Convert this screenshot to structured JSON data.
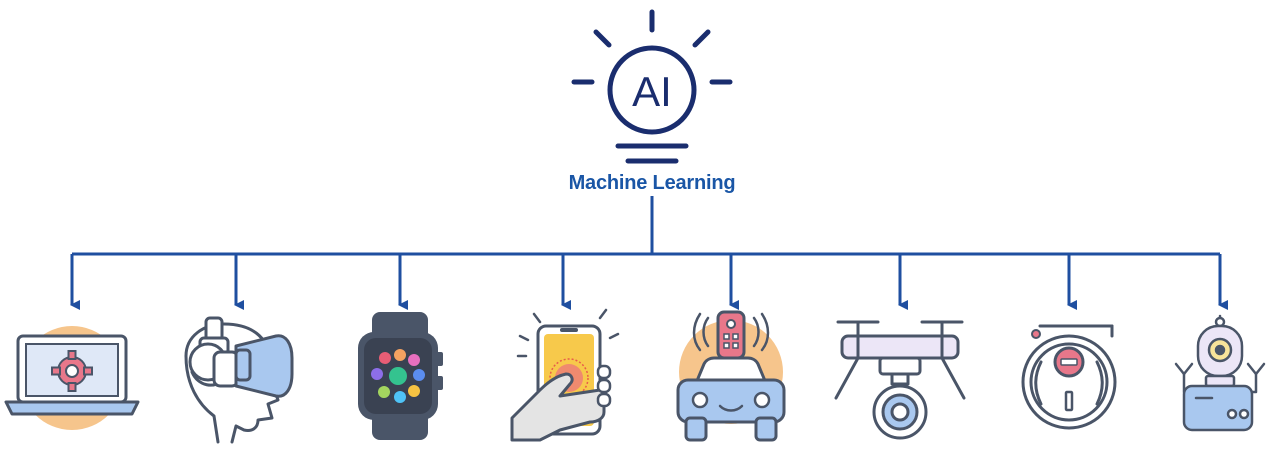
{
  "header": {
    "bulb_text": "AI",
    "title": "Machine Learning"
  },
  "devices": [
    {
      "name": "laptop-gear-icon"
    },
    {
      "name": "vr-headset-icon"
    },
    {
      "name": "smartwatch-icon"
    },
    {
      "name": "smartphone-touch-icon"
    },
    {
      "name": "remote-controlled-car-icon"
    },
    {
      "name": "camera-drone-icon"
    },
    {
      "name": "robot-vacuum-icon"
    },
    {
      "name": "robot-icon"
    }
  ],
  "colors": {
    "navy": "#1a2d6e",
    "connector_blue": "#1f4fa0",
    "title_blue": "#1a56a6",
    "outline": "#4a5568",
    "accent_orange": "#f6c58c",
    "accent_light_blue": "#a9c8ef",
    "accent_yellow": "#f7c94b"
  }
}
